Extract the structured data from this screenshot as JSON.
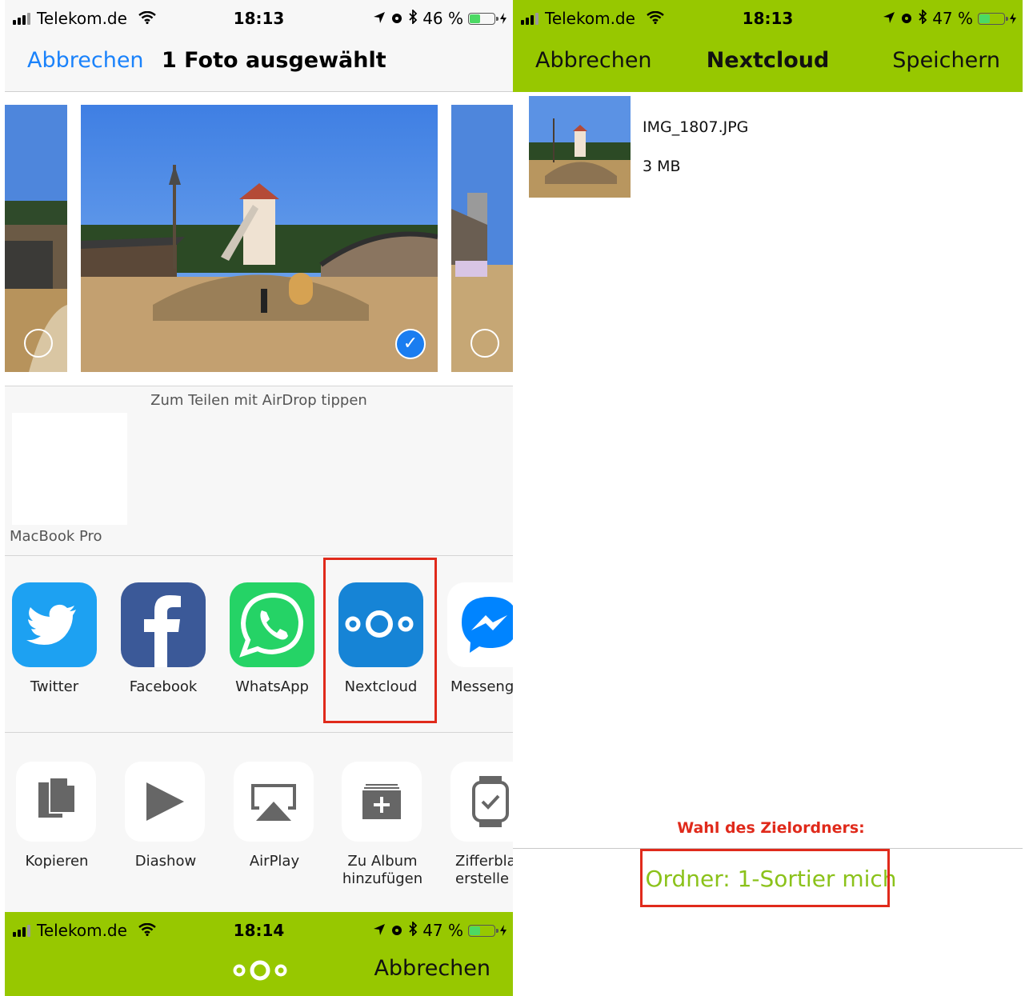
{
  "left": {
    "status_bar": {
      "carrier": "Telekom.de",
      "time": "18:13",
      "battery": "46 %",
      "battery_level": 0.46
    },
    "nav": {
      "cancel": "Abbrechen",
      "title": "1 Foto ausgewählt"
    },
    "airdrop": {
      "hint": "Zum Teilen mit AirDrop tippen",
      "device": "MacBook Pro"
    },
    "apps": [
      {
        "label": "Twitter",
        "icon": "twitter-icon"
      },
      {
        "label": "Facebook",
        "icon": "facebook-icon"
      },
      {
        "label": "WhatsApp",
        "icon": "whatsapp-icon"
      },
      {
        "label": "Nextcloud",
        "icon": "nextcloud-icon"
      },
      {
        "label": "Messeng",
        "icon": "messenger-icon"
      }
    ],
    "actions": [
      {
        "label": "Kopieren",
        "icon": "copy-icon"
      },
      {
        "label": "Diashow",
        "icon": "play-icon"
      },
      {
        "label": "AirPlay",
        "icon": "airplay-icon"
      },
      {
        "label": "Zu Album\nhinzufügen",
        "icon": "add-album-icon"
      },
      {
        "label": "Zifferbla\nerstelle",
        "icon": "watch-icon"
      }
    ],
    "bottom": {
      "status_bar": {
        "carrier": "Telekom.de",
        "time": "18:14",
        "battery": "47 %",
        "battery_level": 0.47
      },
      "cancel": "Abbrechen"
    }
  },
  "right": {
    "status_bar": {
      "carrier": "Telekom.de",
      "time": "18:13",
      "battery": "47 %",
      "battery_level": 0.47
    },
    "nav": {
      "cancel": "Abbrechen",
      "title": "Nextcloud",
      "save": "Speichern"
    },
    "file": {
      "name": "IMG_1807.JPG",
      "size": "3 MB"
    },
    "hint": "Wahl des Zielordners:",
    "folder": "Ordner: 1-Sortier mich"
  },
  "colors": {
    "accent_blue": "#1a82fb",
    "nextcloud_green": "#97c800",
    "annotation_red": "#e02a1b",
    "folder_green": "#8bc21a"
  }
}
